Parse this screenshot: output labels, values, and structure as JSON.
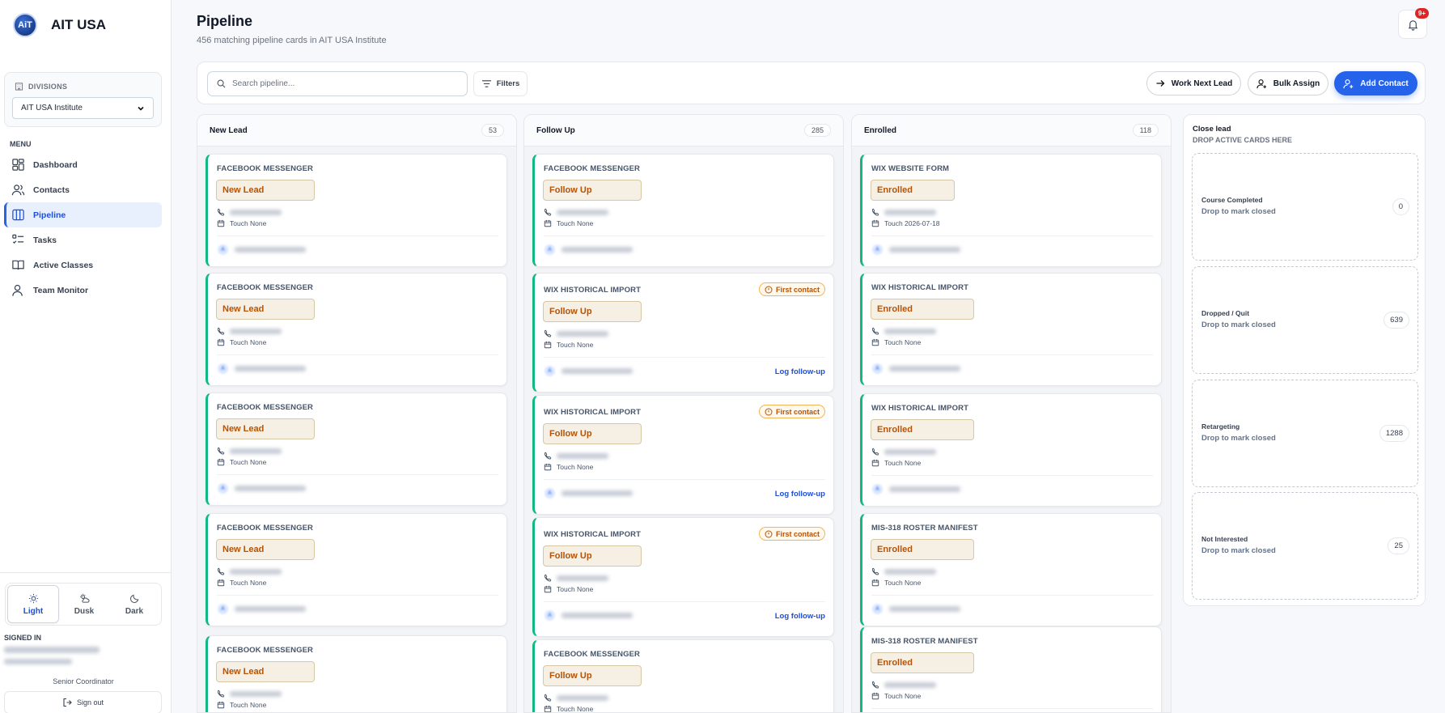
{
  "brand": {
    "logo": "AiT",
    "name": "AIT USA"
  },
  "divisions": {
    "label": "DIVISIONS",
    "selected": "AIT USA Institute"
  },
  "menu": {
    "label": "MENU",
    "items": [
      {
        "label": "Dashboard",
        "icon": "dashboard-icon"
      },
      {
        "label": "Contacts",
        "icon": "contacts-icon"
      },
      {
        "label": "Pipeline",
        "icon": "pipeline-icon",
        "active": true
      },
      {
        "label": "Tasks",
        "icon": "tasks-icon"
      },
      {
        "label": "Active Classes",
        "icon": "book-icon"
      },
      {
        "label": "Team Monitor",
        "icon": "team-icon"
      }
    ]
  },
  "theme": {
    "options": [
      "Light",
      "Dusk",
      "Dark"
    ],
    "selected": "Light"
  },
  "account": {
    "signed_in_label": "SIGNED IN",
    "role": "Senior Coordinator",
    "sign_out": "Sign out"
  },
  "header": {
    "title": "Pipeline",
    "subtitle": "456 matching pipeline cards in AIT USA Institute",
    "notifications": "9+"
  },
  "toolbar": {
    "search_placeholder": "Search pipeline...",
    "filters": "Filters",
    "work_next": "Work Next Lead",
    "bulk_assign": "Bulk Assign",
    "add_contact": "Add Contact"
  },
  "columns": [
    {
      "title": "New Lead",
      "count": "53",
      "cards": [
        {
          "source": "FACEBOOK MESSENGER",
          "stage": "New Lead",
          "touch": "Touch None"
        },
        {
          "source": "FACEBOOK MESSENGER",
          "stage": "New Lead",
          "touch": "Touch None"
        },
        {
          "source": "FACEBOOK MESSENGER",
          "stage": "New Lead",
          "touch": "Touch None"
        },
        {
          "source": "FACEBOOK MESSENGER",
          "stage": "New Lead",
          "touch": "Touch None"
        },
        {
          "source": "FACEBOOK MESSENGER",
          "stage": "New Lead",
          "touch": "Touch None"
        }
      ]
    },
    {
      "title": "Follow Up",
      "count": "285",
      "cards": [
        {
          "source": "FACEBOOK MESSENGER",
          "stage": "Follow Up",
          "touch": "Touch None"
        },
        {
          "source": "WIX HISTORICAL IMPORT",
          "stage": "Follow Up",
          "touch": "Touch None",
          "badge": "First contact",
          "action": "Log follow-up"
        },
        {
          "source": "WIX HISTORICAL IMPORT",
          "stage": "Follow Up",
          "touch": "Touch None",
          "badge": "First contact",
          "action": "Log follow-up"
        },
        {
          "source": "WIX HISTORICAL IMPORT",
          "stage": "Follow Up",
          "touch": "Touch None",
          "badge": "First contact",
          "action": "Log follow-up"
        },
        {
          "source": "FACEBOOK MESSENGER",
          "stage": "Follow Up",
          "touch": "Touch None"
        }
      ]
    },
    {
      "title": "Enrolled",
      "count": "118",
      "cards": [
        {
          "source": "WIX WEBSITE FORM",
          "stage": "Enrolled",
          "touch": "Touch 2026-07-18"
        },
        {
          "source": "WIX HISTORICAL IMPORT",
          "stage": "Enrolled",
          "touch": "Touch None"
        },
        {
          "source": "WIX HISTORICAL IMPORT",
          "stage": "Enrolled",
          "touch": "Touch None"
        },
        {
          "source": "MIS-318 ROSTER MANIFEST",
          "stage": "Enrolled",
          "touch": "Touch None"
        },
        {
          "source": "MIS-318 ROSTER MANIFEST",
          "stage": "Enrolled",
          "touch": "Touch None"
        }
      ]
    }
  ],
  "close_lead": {
    "title": "Close lead",
    "subtitle": "DROP ACTIVE CARDS HERE",
    "zones": [
      {
        "name": "Course Completed",
        "hint": "Drop to mark closed",
        "count": "0"
      },
      {
        "name": "Dropped / Quit",
        "hint": "Drop to mark closed",
        "count": "639"
      },
      {
        "name": "Retargeting",
        "hint": "Drop to mark closed",
        "count": "1288"
      },
      {
        "name": "Not Interested",
        "hint": "Drop to mark closed",
        "count": "25"
      }
    ]
  }
}
